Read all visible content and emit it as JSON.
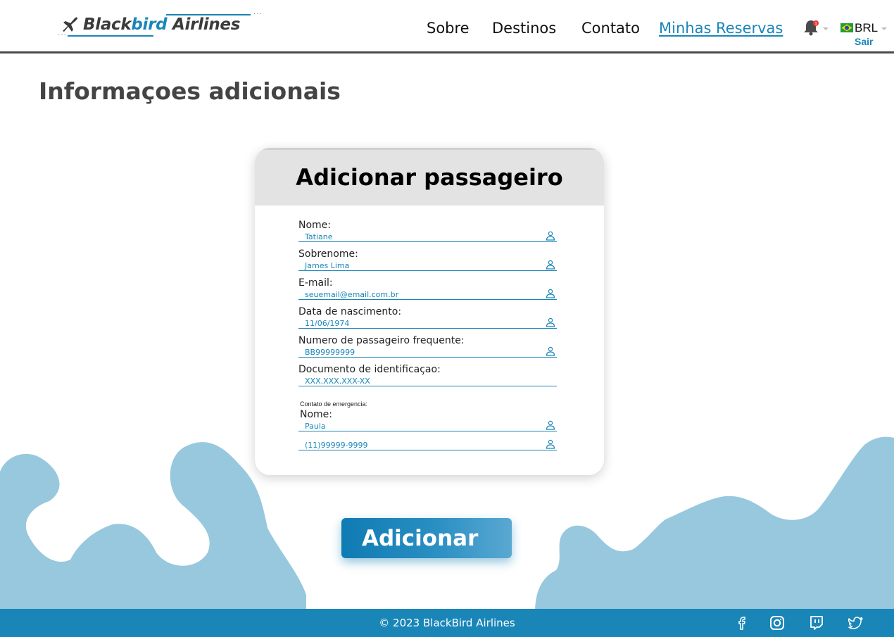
{
  "header": {
    "logo": {
      "brand_dark": "Black",
      "brand_blue": "bird",
      "brand_rest": " Airlines"
    },
    "nav": [
      "Sobre",
      "Destinos",
      "Contato",
      "Minhas Reservas"
    ],
    "notification_count": "1",
    "currency": "BRL",
    "logout": "Sair"
  },
  "page": {
    "title": "Informaçoes adicionais"
  },
  "form": {
    "title": "Adicionar passageiro",
    "fields": [
      {
        "label": "Nome:",
        "value": "Tatiane"
      },
      {
        "label": "Sobrenome:",
        "value": "James Lima"
      },
      {
        "label": "E-mail:",
        "value": "seuemail@email.com.br"
      },
      {
        "label": "Data de nascimento:",
        "value": "11/06/1974"
      },
      {
        "label": "Numero de passageiro frequente:",
        "value": "BB99999999"
      },
      {
        "label": "Documento de identificaçao:",
        "value": "XXX.XXX.XXX-XX"
      }
    ],
    "emergency": {
      "caption": "Contato de emergencia:",
      "name_label": "Nome:",
      "name_value": "Paula",
      "phone_value": "(11)99999-9999"
    }
  },
  "actions": {
    "add_label": "Adicionar"
  },
  "footer": {
    "copyright": "© 2023 BlackBird Airlines",
    "social": [
      "facebook-icon",
      "instagram-icon",
      "twitch-icon",
      "twitter-icon"
    ]
  },
  "colors": {
    "accent": "#1a86b8",
    "blob": "#97c8de",
    "header_border": "#4a4a4a",
    "title": "#444444"
  }
}
